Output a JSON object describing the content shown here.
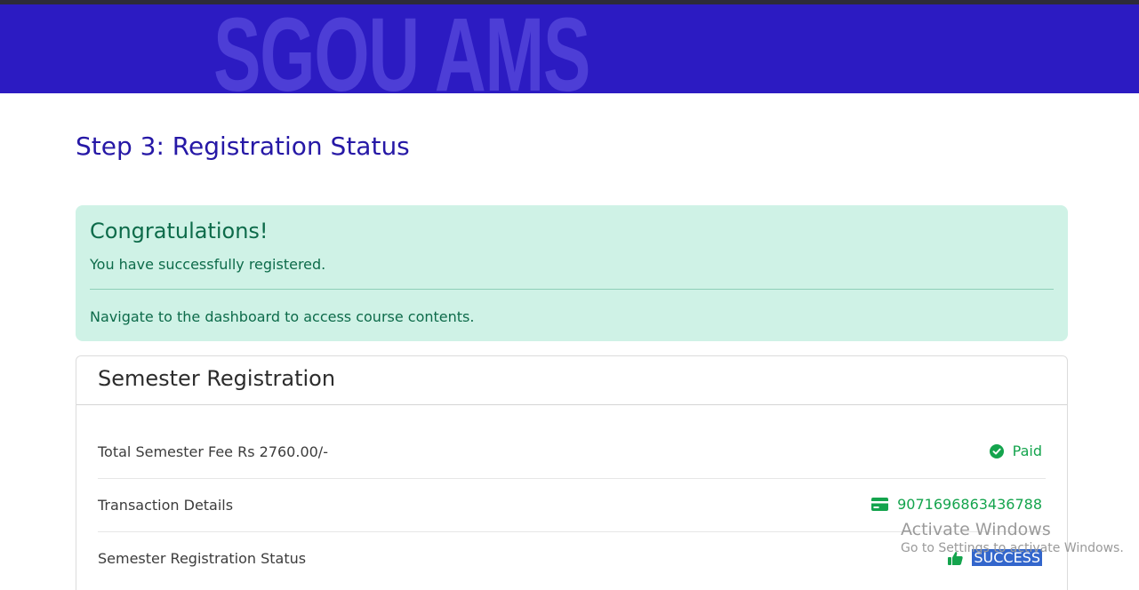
{
  "banner": {
    "title": "SGOU AMS"
  },
  "page": {
    "step_title": "Step 3: Registration Status"
  },
  "alert": {
    "heading": "Congratulations!",
    "message": "You have successfully registered.",
    "note": "Navigate to the dashboard to access course contents."
  },
  "card": {
    "title": "Semester Registration",
    "rows": [
      {
        "label": "Total Semester Fee Rs 2760.00/-",
        "value": "Paid",
        "icon": "check-circle-icon"
      },
      {
        "label": "Transaction Details",
        "value": "9071696863436788",
        "icon": "credit-card-icon"
      },
      {
        "label": "Semester Registration Status",
        "value": "SUCCESS",
        "icon": "thumbs-up-icon"
      }
    ]
  },
  "watermark": {
    "title": "Activate Windows",
    "subtitle": "Go to Settings to activate Windows."
  },
  "colors": {
    "banner": "#2c1bc2",
    "title": "#2618a6",
    "success": "#14a44d",
    "alert_bg": "#cff2e6"
  }
}
